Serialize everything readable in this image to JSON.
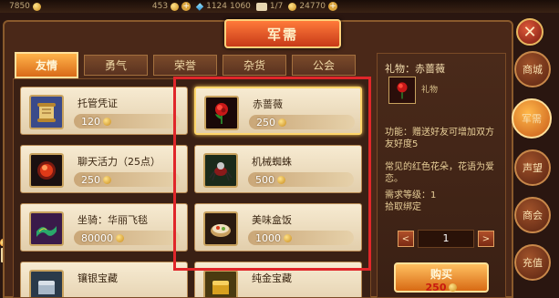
{
  "topbar": {
    "res1": "7850",
    "res2": "453",
    "res3": "1124",
    "res4": "1060",
    "res5": "1/7",
    "res6": "24770"
  },
  "title": "军需",
  "tabs": [
    {
      "label": "友情",
      "active": true
    },
    {
      "label": "勇气",
      "active": false
    },
    {
      "label": "荣誉",
      "active": false
    },
    {
      "label": "杂货",
      "active": false
    },
    {
      "label": "公会",
      "active": false
    }
  ],
  "items": [
    {
      "name": "托管凭证",
      "price": "120",
      "icon": "scroll-icon",
      "selected": false
    },
    {
      "name": "赤蔷薇",
      "price": "250",
      "icon": "red-rose-icon",
      "selected": true
    },
    {
      "name": "聊天活力（25点）",
      "price": "250",
      "icon": "red-orb-icon",
      "selected": false
    },
    {
      "name": "机械蜘蛛",
      "price": "500",
      "icon": "mech-spider-icon",
      "selected": false
    },
    {
      "name": "坐骑：华丽飞毯",
      "price": "80000",
      "icon": "flying-carpet-icon",
      "selected": false
    },
    {
      "name": "美味盒饭",
      "price": "1000",
      "icon": "lunch-box-icon",
      "selected": false
    },
    {
      "name": "镶银宝藏",
      "price": "",
      "icon": "silver-chest-icon",
      "selected": false
    },
    {
      "name": "纯金宝藏",
      "price": "",
      "icon": "gold-chest-icon",
      "selected": false
    }
  ],
  "detail": {
    "title": "礼物：赤蔷薇",
    "category": "礼物",
    "description": "功能：赠送好友可增加双方友好度5",
    "flavor": "常见的红色花朵，花语为爱恋。",
    "requirement": "需求等级：1",
    "binding": "拾取绑定",
    "quantity": "1",
    "buy_label": "购买",
    "buy_price": "250"
  },
  "sidenav": [
    {
      "label": "商城",
      "active": false
    },
    {
      "label": "军需",
      "active": true
    },
    {
      "label": "声望",
      "active": false
    },
    {
      "label": "商会",
      "active": false
    },
    {
      "label": "充值",
      "active": false
    }
  ],
  "colors": {
    "accent": "#ff9a2a",
    "highlight_box": "#e0262a",
    "price_text": "#c81a10"
  }
}
